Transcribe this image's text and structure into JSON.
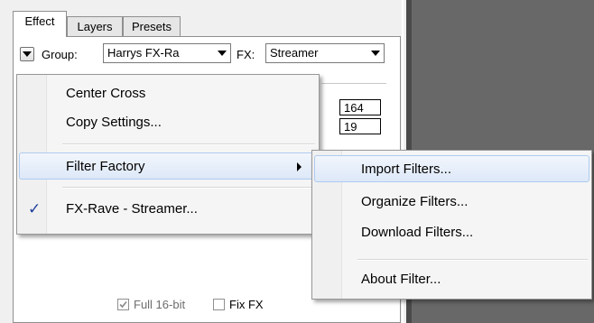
{
  "tabs": [
    {
      "label": "Effect",
      "active": true
    },
    {
      "label": "Layers",
      "active": false
    },
    {
      "label": "Presets",
      "active": false
    }
  ],
  "toolbar": {
    "group_label": "Group:",
    "group_value": "Harrys FX-Ra",
    "fx_label": "FX:",
    "fx_value": "Streamer"
  },
  "fields": {
    "value1": "164",
    "value2": "19"
  },
  "checkboxes": {
    "full16bit": {
      "label": "Full 16-bit",
      "checked": true,
      "disabled": true
    },
    "fixfx": {
      "label": "Fix FX",
      "checked": false,
      "disabled": false
    }
  },
  "menu": {
    "items": [
      {
        "label": "Center Cross"
      },
      {
        "label": "Copy Settings..."
      },
      {
        "label": "Filter Factory",
        "submenu": true,
        "highlighted": true
      },
      {
        "label": "FX-Rave - Streamer...",
        "checked": true
      }
    ]
  },
  "submenu": {
    "items": [
      {
        "label": "Import Filters...",
        "highlighted": true
      },
      {
        "label": "Organize Filters..."
      },
      {
        "label": "Download Filters..."
      },
      {
        "label": "About Filter..."
      }
    ]
  },
  "colors": {
    "accent_highlight": "#dde8f8",
    "check_color": "#1e3f9a",
    "dark_area": "#686868"
  },
  "icons": {
    "group_button": "triangle-down-icon",
    "menu_check": "check-icon",
    "submenu_arrow": "chevron-right-icon"
  }
}
